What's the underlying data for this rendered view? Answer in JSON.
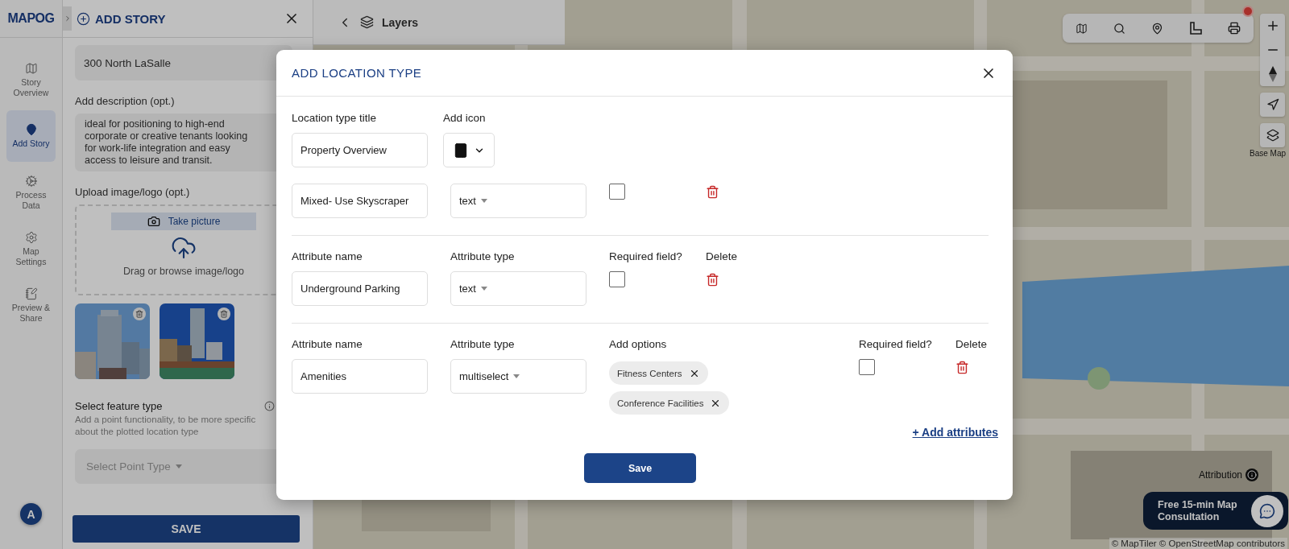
{
  "logo": "MAPOG",
  "rail": [
    {
      "label": "Story Overview",
      "selected": false
    },
    {
      "label": "Add Story",
      "selected": true
    },
    {
      "label": "Process Data",
      "selected": false
    },
    {
      "label": "Map Settings",
      "selected": false
    },
    {
      "label": "Preview & Share",
      "selected": false
    }
  ],
  "avatar": "A",
  "panel": {
    "title": "ADD STORY",
    "story_name": "300 North LaSalle",
    "description_label": "Add description (opt.)",
    "description": "ideal for positioning to high-end corporate or creative tenants looking for work-life integration and easy access to leisure and transit.",
    "upload_label": "Upload image/logo (opt.)",
    "take_picture": "Take picture",
    "drop_hint": "Drag or browse image/logo",
    "feature_label": "Select feature type",
    "feature_hint": "Add a point functionality, to be more specific about the plotted location type",
    "feature_select": {
      "placeholder": "Select Point Type"
    },
    "save": "SAVE"
  },
  "map": {
    "layers": "Layers",
    "base_map": "Base Map",
    "attribution": "Attribution",
    "consultation": "Free 15-min Map Consultation",
    "credits": "© MapTiler © OpenStreetMap contributors"
  },
  "modal": {
    "title": "ADD LOCATION TYPE",
    "title_label": "Location type title",
    "title_value": "Property Overview",
    "icon_label": "Add icon",
    "attributes": [
      {
        "name": "Mixed- Use Skyscraper",
        "type": "text",
        "required": false
      },
      {
        "labels": {
          "name": "Attribute name",
          "type": "Attribute type",
          "required": "Required field?",
          "delete": "Delete"
        },
        "name": "Underground Parking",
        "type": "text",
        "required": false
      },
      {
        "labels": {
          "name": "Attribute name",
          "type": "Attribute type",
          "options": "Add options",
          "required": "Required field?",
          "delete": "Delete"
        },
        "name": "Amenities",
        "type": "multiselect",
        "options": [
          "Fitness Centers",
          "Conference Facilities"
        ],
        "required": false
      }
    ],
    "add_attributes": "+ Add attributes",
    "save": "Save"
  }
}
